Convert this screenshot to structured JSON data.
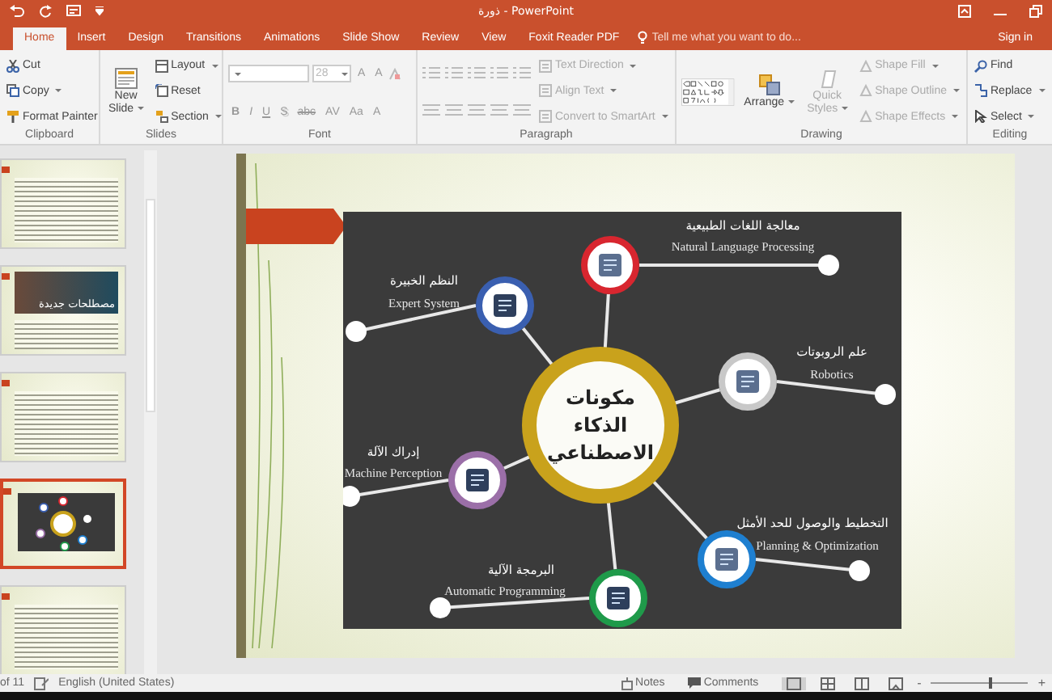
{
  "window": {
    "title": "ذورة - PowerPoint"
  },
  "tabs": [
    {
      "label": "Home",
      "selected": true
    },
    {
      "label": "Insert",
      "selected": false
    },
    {
      "label": "Design",
      "selected": false
    },
    {
      "label": "Transitions",
      "selected": false
    },
    {
      "label": "Animations",
      "selected": false
    },
    {
      "label": "Slide Show",
      "selected": false
    },
    {
      "label": "Review",
      "selected": false
    },
    {
      "label": "View",
      "selected": false
    },
    {
      "label": "Foxit Reader PDF",
      "selected": false
    }
  ],
  "tell_me": {
    "placeholder": "Tell me what you want to do..."
  },
  "sign_in": "Sign in",
  "ribbon": {
    "clipboard": {
      "label": "Clipboard",
      "items": [
        "Cut",
        "Copy",
        "Format Painter"
      ]
    },
    "slides": {
      "label": "Slides",
      "new_slide": [
        "New",
        "Slide"
      ],
      "items": [
        "Layout",
        "Reset",
        "Section"
      ]
    },
    "font": {
      "label": "Font",
      "size": "28",
      "size_buttons": [
        "A",
        "A"
      ],
      "buttons": [
        "B",
        "I",
        "U",
        "S",
        "abc",
        "AV",
        "Aa",
        "A"
      ]
    },
    "paragraph": {
      "label": "Paragraph",
      "items": [
        {
          "label": "Text Direction",
          "disabled": true
        },
        {
          "label": "Align Text",
          "disabled": true
        },
        {
          "label": "Convert to SmartArt",
          "disabled": true
        }
      ]
    },
    "drawing": {
      "label": "Drawing",
      "arrange": "Arrange",
      "quick_styles": {
        "label": [
          "Quick",
          "Styles"
        ],
        "disabled": true
      },
      "items": [
        {
          "label": "Shape Fill",
          "disabled": true
        },
        {
          "label": "Shape Outline",
          "disabled": true
        },
        {
          "label": "Shape Effects",
          "disabled": true
        }
      ]
    },
    "editing": {
      "label": "Editing",
      "items": [
        "Find",
        "Replace",
        "Select"
      ]
    }
  },
  "thumbnails": [
    {
      "kind": "text",
      "selected": false
    },
    {
      "kind": "banner",
      "selected": false,
      "title": "مصطلحات جديدة"
    },
    {
      "kind": "text",
      "selected": false
    },
    {
      "kind": "diagram",
      "selected": true
    },
    {
      "kind": "text",
      "selected": false
    }
  ],
  "slide": {
    "center": [
      "مكونات",
      "الذكاء",
      "الاصطناعي"
    ],
    "nodes": [
      {
        "arabic": "معالجة اللغات الطبيعية",
        "english": "Natural Language Processing",
        "color": "#d8262f"
      },
      {
        "arabic": "النظم الخبيرة",
        "english": "Expert System",
        "color": "#3a5fb0"
      },
      {
        "arabic": "علم الروبوتات",
        "english": "Robotics",
        "color": "#c8c8c8"
      },
      {
        "arabic": "إدراك الآلة",
        "english": "Machine Perception",
        "color": "#9b6fa8"
      },
      {
        "arabic": "التخطيط والوصول للحد الأمثل",
        "english": "Planning & Optimization",
        "color": "#1e7fd0"
      },
      {
        "arabic": "البرمجة الآلية",
        "english": "Automatic Programming",
        "color": "#1f9a4a"
      }
    ]
  },
  "status_bar": {
    "slide_count": "of 11",
    "language": "English (United States)",
    "notes": "Notes",
    "comments": "Comments",
    "views": [
      {
        "selected": true
      },
      {
        "selected": false
      },
      {
        "selected": false
      },
      {
        "selected": false
      }
    ],
    "zoom": {
      "minus": "-",
      "plus": "+",
      "level": 0.6
    }
  }
}
